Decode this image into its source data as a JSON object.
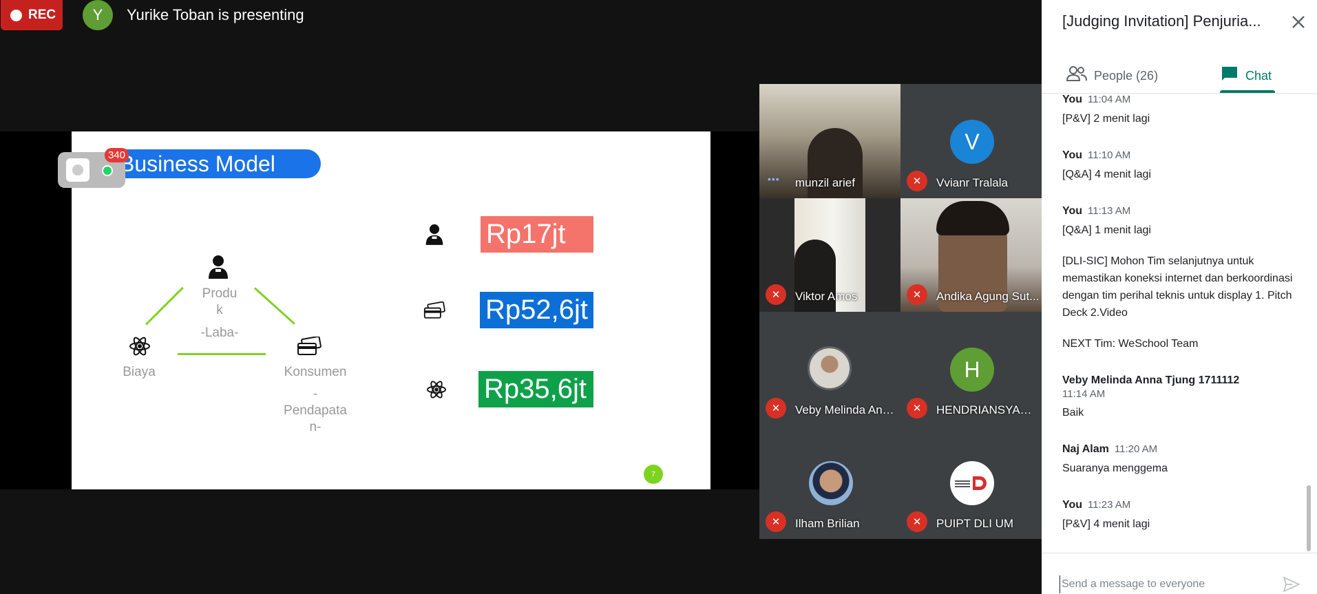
{
  "top_bar": {
    "rec_label": "REC",
    "presenter_initial": "Y",
    "presenter_text": "Yurike Toban is presenting"
  },
  "slide": {
    "title": "Business Model",
    "badge_count": "340",
    "nodes": {
      "produk_line1": "Produ",
      "produk_line2": "k",
      "laba": "-Laba-",
      "biaya": "Biaya",
      "konsumen": "Konsumen",
      "pendapatan_line1": "-",
      "pendapatan_line2": "Pendapata",
      "pendapatan_line3": "n-"
    },
    "amounts": [
      {
        "label": "Rp17jt",
        "color": "#f4736a"
      },
      {
        "label": "Rp52,6jt",
        "color": "#0b6fd6"
      },
      {
        "label": "Rp35,6jt",
        "color": "#0fa14a"
      }
    ],
    "page_number": "7"
  },
  "participants": [
    {
      "name": "munzil arief",
      "type": "video",
      "muted": false
    },
    {
      "name": "Vvianr Tralala",
      "type": "letter",
      "initial": "V",
      "color": "#1a84d6",
      "muted": true
    },
    {
      "name": "Viktor Amos",
      "type": "video",
      "muted": true
    },
    {
      "name": "Andika Agung Sut...",
      "type": "video",
      "muted": true
    },
    {
      "name": "Veby Melinda Ann...",
      "type": "photo",
      "muted": true
    },
    {
      "name": "HENDRIANSYAH ...",
      "type": "letter",
      "initial": "H",
      "color": "#5e9e34",
      "muted": true
    },
    {
      "name": "Ilham Brilian",
      "type": "photo",
      "muted": true
    },
    {
      "name": "PUIPT DLI UM",
      "type": "logo",
      "muted": true
    }
  ],
  "panel": {
    "title": "[Judging Invitation] Penjuria...",
    "people_tab": "People (26)",
    "chat_tab": "Chat",
    "messages": [
      {
        "sender": "You",
        "time": "11:04 AM",
        "lines": [
          "[P&V] 2 menit lagi"
        ]
      },
      {
        "sender": "You",
        "time": "11:10 AM",
        "lines": [
          "[Q&A] 4 menit lagi"
        ]
      },
      {
        "sender": "You",
        "time": "11:13 AM",
        "lines": [
          "[Q&A] 1 menit lagi",
          "[DLI-SIC] Mohon Tim selanjutnya untuk memastikan koneksi internet dan berkoordinasi dengan tim perihal teknis untuk display 1. Pitch Deck 2.Video",
          "NEXT Tim: WeSchool Team"
        ]
      },
      {
        "sender": "Veby Melinda Anna Tjung 1711112",
        "time": "11:14 AM",
        "lines": [
          "Baik"
        ]
      },
      {
        "sender": "Naj Alam",
        "time": "11:20 AM",
        "lines": [
          "Suaranya menggema"
        ]
      },
      {
        "sender": "You",
        "time": "11:23 AM",
        "lines": [
          "[P&V] 4 menit lagi"
        ]
      }
    ],
    "input_placeholder": "Send a message to everyone"
  }
}
